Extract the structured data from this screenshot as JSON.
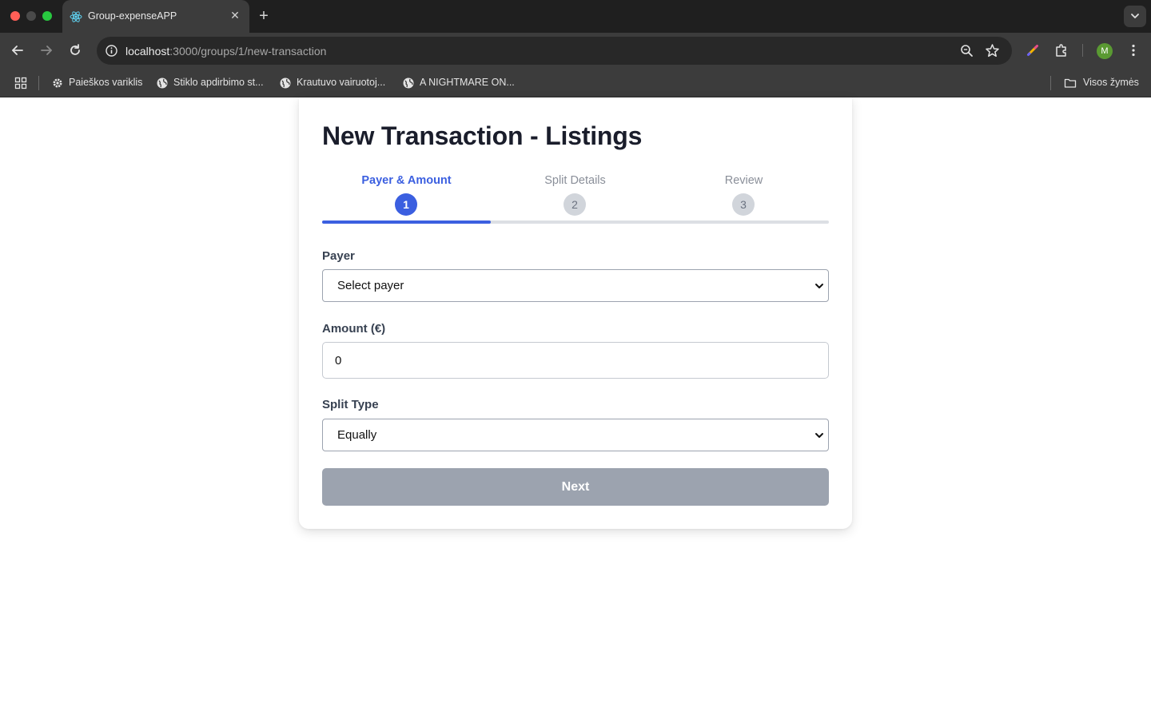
{
  "browser": {
    "tab": {
      "title": "Group-expenseAPP",
      "favicon": "react-logo-icon"
    },
    "address": {
      "host": "localhost",
      "path": ":3000/groups/1/new-transaction"
    },
    "avatar_initial": "M",
    "bookmarks": [
      {
        "label": "Paieškos variklis",
        "icon": "gear-icon"
      },
      {
        "label": "Stiklo apdirbimo st...",
        "icon": "globe-icon"
      },
      {
        "label": "Krautuvo vairuotoj...",
        "icon": "globe-icon"
      },
      {
        "label": "A NIGHTMARE ON...",
        "icon": "globe-icon"
      }
    ],
    "all_bookmarks": "Visos žymės"
  },
  "page": {
    "title": "New Transaction - Listings",
    "steps": [
      {
        "label": "Payer & Amount",
        "number": "1",
        "active": true
      },
      {
        "label": "Split Details",
        "number": "2",
        "active": false
      },
      {
        "label": "Review",
        "number": "3",
        "active": false
      }
    ],
    "step_progress": 0.3333,
    "form": {
      "payer_label": "Payer",
      "payer_value": "Select payer",
      "amount_label": "Amount (€)",
      "amount_value": "0",
      "split_label": "Split Type",
      "split_value": "Equally"
    },
    "next_label": "Next"
  },
  "colors": {
    "accent": "#3b5fe0",
    "button_disabled": "#9ca3af"
  }
}
